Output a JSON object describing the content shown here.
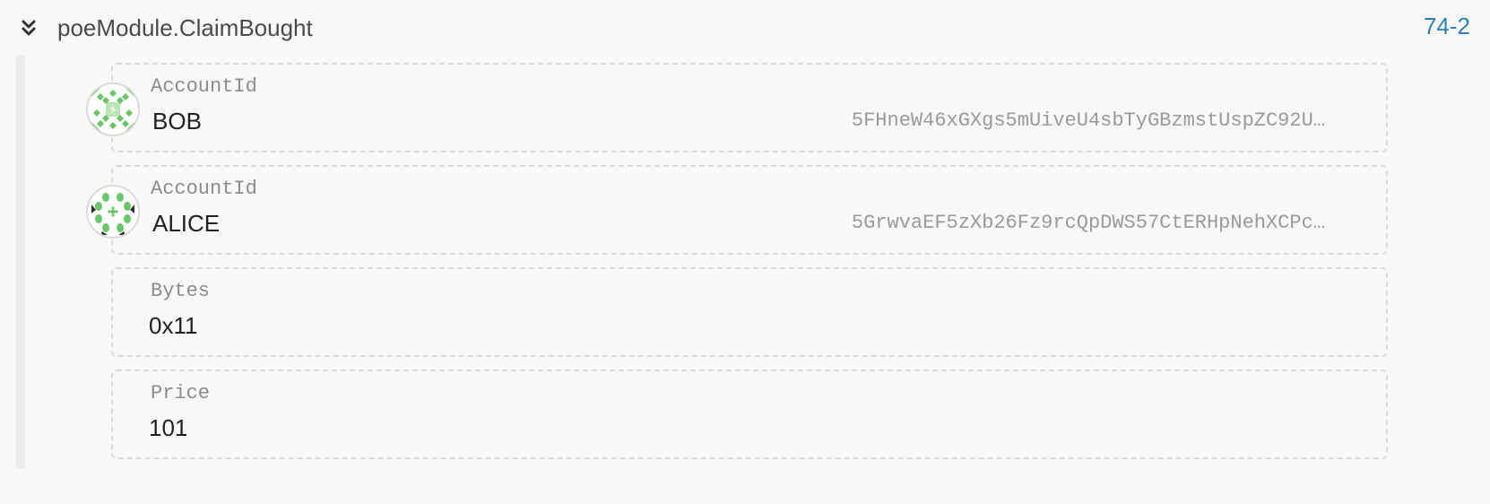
{
  "event": {
    "title": "poeModule.ClaimBought",
    "id": "74-2"
  },
  "params": [
    {
      "label": "AccountId",
      "name": "BOB",
      "address": "5FHneW46xGXgs5mUiveU4sbTyGBzmstUspZC92U…"
    },
    {
      "label": "AccountId",
      "name": "ALICE",
      "address": "5GrwvaEF5zXb26Fz9rcQpDWS57CtERHpNehXCPc…"
    },
    {
      "label": "Bytes",
      "value": "0x11"
    },
    {
      "label": "Price",
      "value": "101"
    }
  ],
  "icons": {
    "expand": "double-chevron-down-icon",
    "identicon_bob": "identicon-bob",
    "identicon_alice": "identicon-alice"
  },
  "colors": {
    "link": "#2f80b5",
    "identicon_green": "#6cc46a",
    "border": "#dcdad6"
  }
}
